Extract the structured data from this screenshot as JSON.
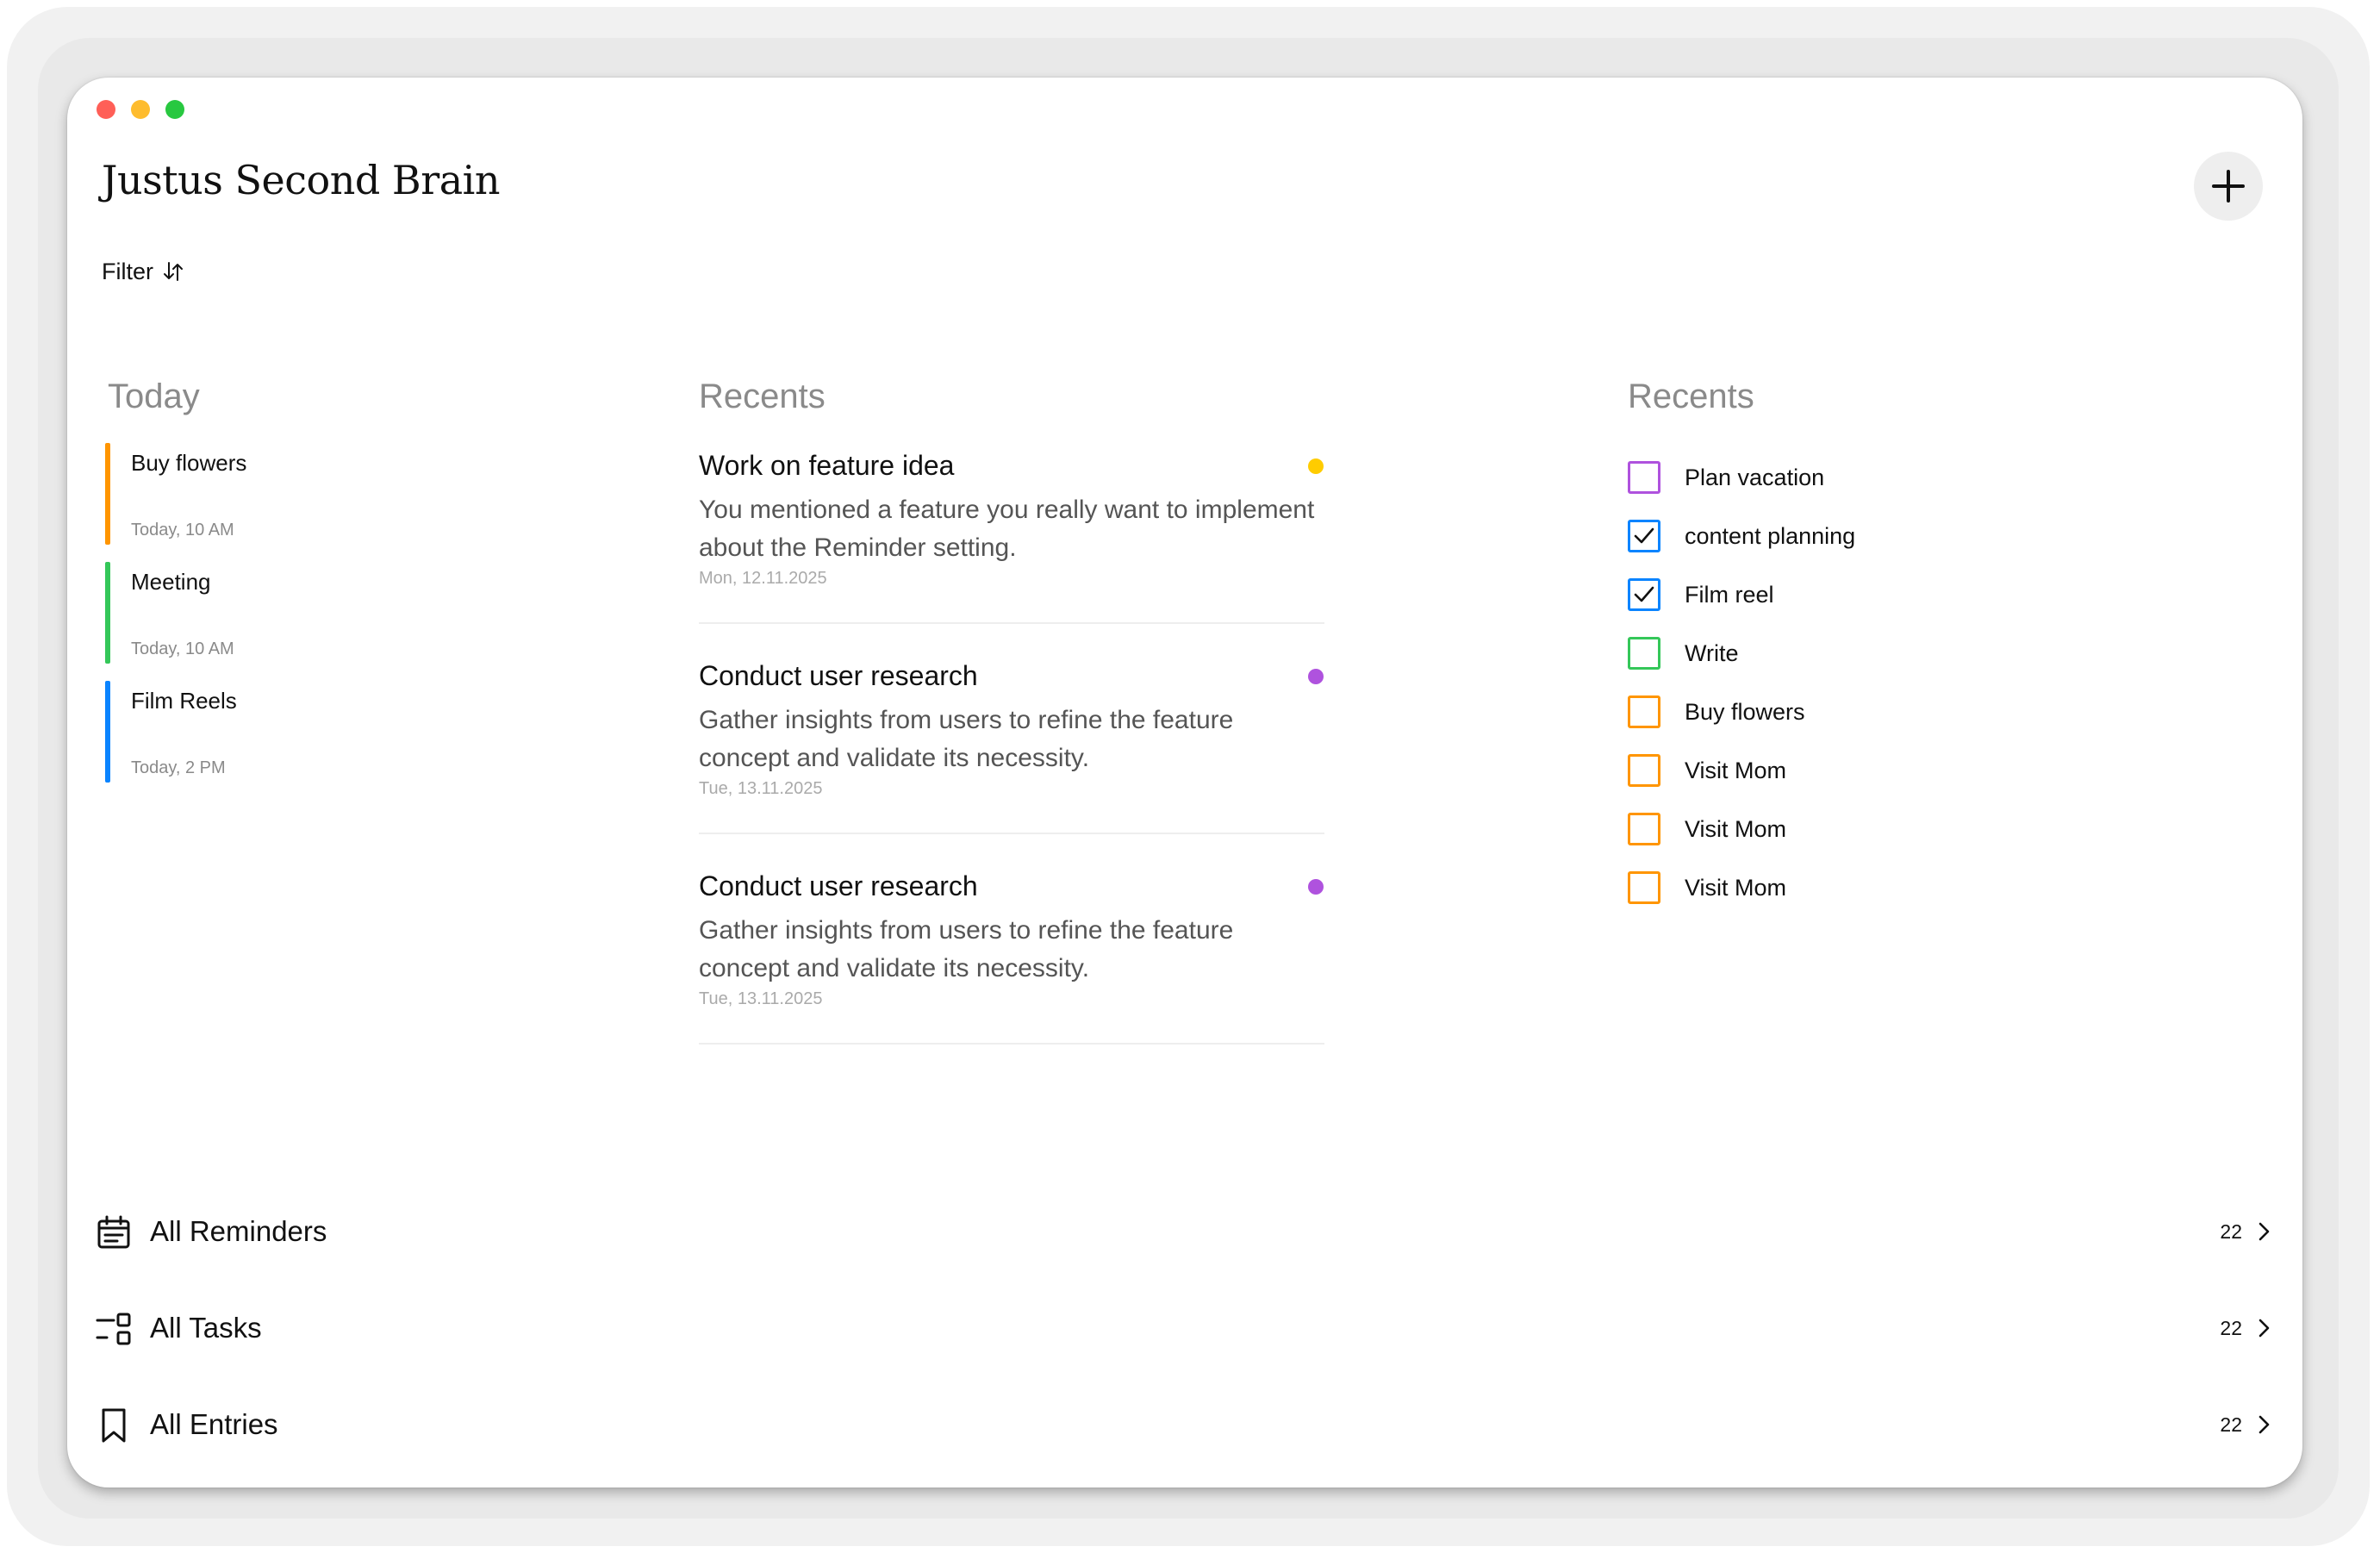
{
  "app": {
    "title": "Justus Second Brain",
    "filter_label": "Filter",
    "add_icon": "plus-icon",
    "filter_icon": "sort-arrows-icon"
  },
  "today": {
    "heading": "Today",
    "items": [
      {
        "title": "Buy flowers",
        "time": "Today, 10 AM",
        "color": "#FF9500"
      },
      {
        "title": "Meeting",
        "time": "Today, 10 AM",
        "color": "#34C759"
      },
      {
        "title": "Film Reels",
        "time": "Today, 2 PM",
        "color": "#0A84FF"
      }
    ]
  },
  "entries": {
    "heading": "Recents",
    "items": [
      {
        "title": "Work on feature idea",
        "body": "You mentioned a feature you really want to implement about the Reminder setting.",
        "date": "Mon, 12.11.2025",
        "dot_color": "#FFCC00"
      },
      {
        "title": "Conduct user research",
        "body": "Gather insights from users to refine the feature concept and validate its necessity.",
        "date": "Tue, 13.11.2025",
        "dot_color": "#AF52DE"
      },
      {
        "title": "Conduct user research",
        "body": "Gather insights from users to refine the feature concept and validate its necessity.",
        "date": "Tue, 13.11.2025",
        "dot_color": "#AF52DE"
      }
    ]
  },
  "tasks": {
    "heading": "Recents",
    "items": [
      {
        "title": "Plan vacation",
        "checked": false,
        "color": "#AF52DE"
      },
      {
        "title": "content planning",
        "checked": true,
        "color": "#0A84FF"
      },
      {
        "title": "Film reel",
        "checked": true,
        "color": "#0A84FF"
      },
      {
        "title": "Write",
        "checked": false,
        "color": "#34C759"
      },
      {
        "title": "Buy flowers",
        "checked": false,
        "color": "#FF9500"
      },
      {
        "title": "Visit Mom",
        "checked": false,
        "color": "#FF9500"
      },
      {
        "title": "Visit Mom",
        "checked": false,
        "color": "#FF9500"
      },
      {
        "title": "Visit Mom",
        "checked": false,
        "color": "#FF9500"
      }
    ]
  },
  "nav": [
    {
      "label": "All Reminders",
      "count": "22",
      "icon": "calendar-icon"
    },
    {
      "label": "All Tasks",
      "count": "22",
      "icon": "tasks-icon"
    },
    {
      "label": "All Entries",
      "count": "22",
      "icon": "bookmark-icon"
    }
  ]
}
